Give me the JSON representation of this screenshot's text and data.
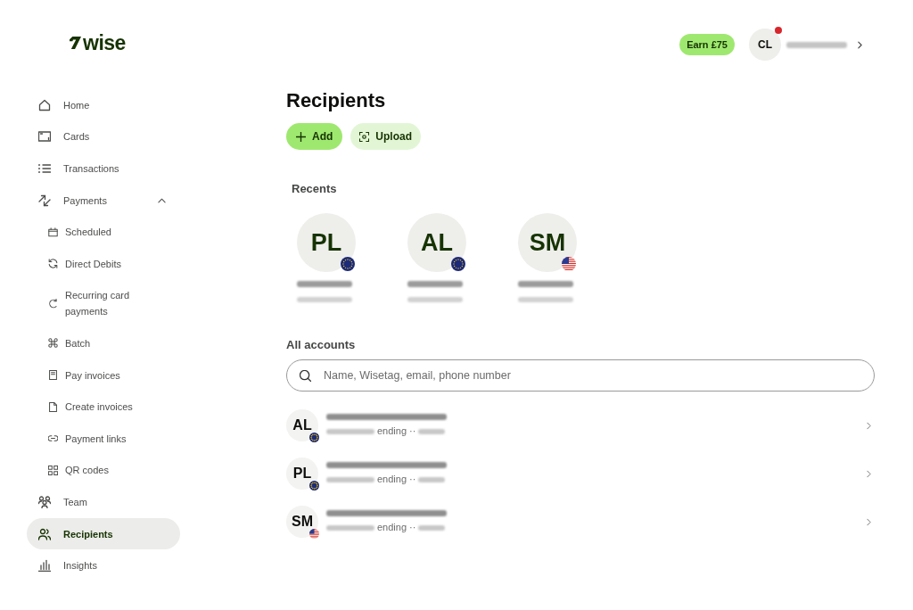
{
  "logo": {
    "text": "wise"
  },
  "sidebar": {
    "items": [
      {
        "label": "Home",
        "selected": false
      },
      {
        "label": "Cards",
        "selected": false
      },
      {
        "label": "Transactions",
        "selected": false
      },
      {
        "label": "Payments",
        "selected": false,
        "expanded": true,
        "children": [
          {
            "label": "Scheduled",
            "selected": false
          },
          {
            "label": "Direct Debits",
            "selected": false
          },
          {
            "label": "Recurring card payments",
            "selected": false
          },
          {
            "label": "Batch",
            "selected": false
          },
          {
            "label": "Pay invoices",
            "selected": false
          },
          {
            "label": "Create invoices",
            "selected": false
          },
          {
            "label": "Payment links",
            "selected": false
          },
          {
            "label": "QR codes",
            "selected": false
          }
        ]
      },
      {
        "label": "Team",
        "selected": false
      },
      {
        "label": "Recipients",
        "selected": true
      },
      {
        "label": "Insights",
        "selected": false
      }
    ]
  },
  "header": {
    "earn_label": "Earn £75",
    "account": {
      "initials": "CL",
      "notification": true
    }
  },
  "page": {
    "title": "Recipients",
    "buttons": [
      {
        "label": "Add",
        "kind": "primary"
      },
      {
        "label": "Upload",
        "kind": "secondary"
      }
    ]
  },
  "recents": {
    "title": "Recents",
    "items": [
      {
        "initials": "PL",
        "kind": "eu"
      },
      {
        "initials": "AL",
        "kind": "eu"
      },
      {
        "initials": "SM",
        "kind": "us"
      }
    ]
  },
  "all_accounts": {
    "title": "All accounts",
    "search": {
      "placeholder": "Name, Wisetag, email, phone number"
    },
    "rows": [
      {
        "initials": "AL",
        "kind": "eu",
        "detail": "ending ··"
      },
      {
        "initials": "PL",
        "kind": "eu",
        "detail": "ending ··"
      },
      {
        "initials": "SM",
        "kind": "us",
        "detail": "ending ··"
      }
    ]
  }
}
